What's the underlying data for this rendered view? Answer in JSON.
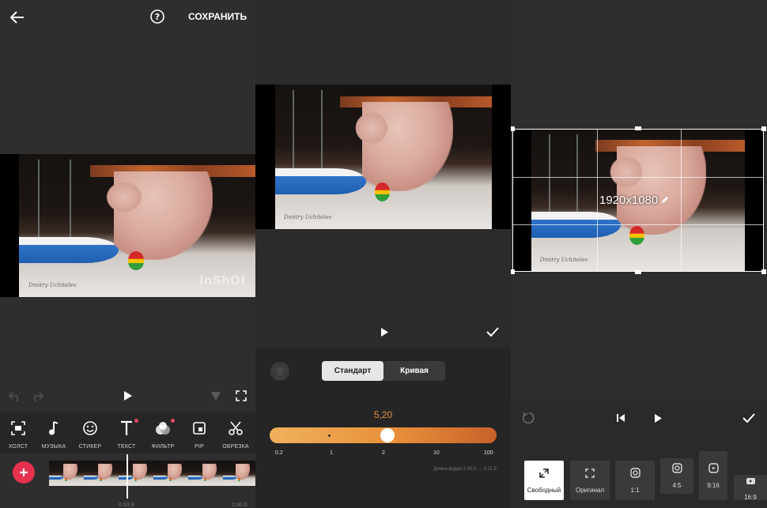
{
  "panel1": {
    "save_label": "СОХРАНИТЬ",
    "watermark": "InShOt",
    "signature": "Dmitry Uchitelev",
    "tools": [
      {
        "label": "ХОЛСТ",
        "icon": "canvas-icon"
      },
      {
        "label": "МУЗЫКА",
        "icon": "music-icon"
      },
      {
        "label": "СТИКЕР",
        "icon": "sticker-icon"
      },
      {
        "label": "ТЕКСТ",
        "icon": "text-icon"
      },
      {
        "label": "ФИЛЬТР",
        "icon": "filter-icon"
      },
      {
        "label": "PIP",
        "icon": "pip-icon"
      },
      {
        "label": "ОБРЕЗКА",
        "icon": "scissors-icon"
      }
    ],
    "time_current": "0:33.9",
    "time_total": "1:00.0"
  },
  "panel2": {
    "signature": "Dmitry Uchitelev",
    "tabs": {
      "standard": "Стандарт",
      "curve": "Кривая"
    },
    "speed_value": "5,20",
    "scale": [
      "0.2",
      "1",
      "2",
      "10",
      "100"
    ],
    "duration_text": "Длина видео:1:00.0  →  0:11.5",
    "speed_slider_fraction": 0.52
  },
  "panel3": {
    "signature": "Dmitry Uchitelev",
    "resolution": "1920x1080",
    "ratios": [
      {
        "label": "Свободный",
        "icon": "free-crop-icon"
      },
      {
        "label": "Оригинал",
        "icon": "original-crop-icon"
      },
      {
        "label": "1:1",
        "icon": "instagram-icon"
      },
      {
        "label": "4:5",
        "icon": "instagram-icon"
      },
      {
        "label": "9:16",
        "icon": "reels-icon"
      },
      {
        "label": "16:9",
        "icon": "youtube-icon"
      }
    ]
  },
  "colors": {
    "accent_orange": "#e8903a",
    "add_button": "#e8304f"
  }
}
